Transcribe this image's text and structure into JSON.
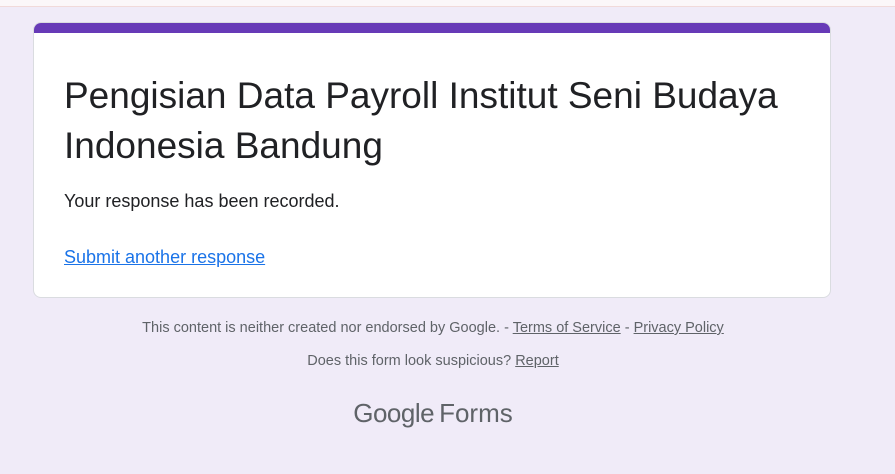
{
  "form": {
    "title": "Pengisian Data Payroll Institut Seni Budaya Indonesia Bandung",
    "confirmation_message": "Your response has been recorded.",
    "submit_another_label": "Submit another response",
    "accent_color": "#673ab7",
    "background_color": "#f0ebf8"
  },
  "footer": {
    "disclaimer_text": "This content is neither created nor endorsed by Google.",
    "separator_1": " - ",
    "terms_label": "Terms of Service",
    "separator_2": " - ",
    "privacy_label": "Privacy Policy",
    "suspicious_text": "Does this form look suspicious?",
    "report_label": "Report"
  },
  "brand": {
    "google_label": "Google",
    "forms_label": "Forms"
  }
}
